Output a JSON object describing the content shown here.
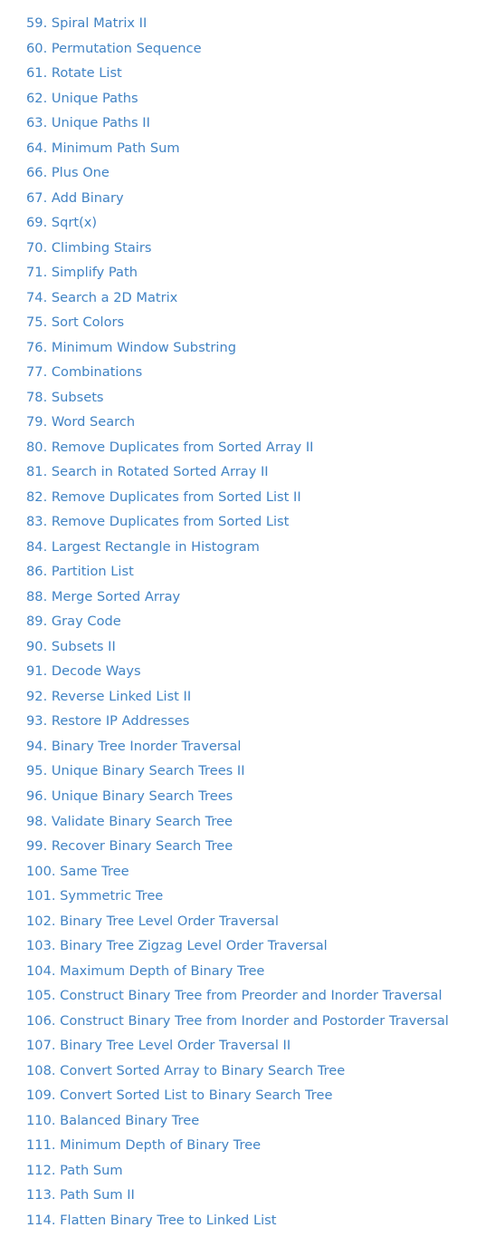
{
  "link_color": "#4183c4",
  "problems": [
    "59. Spiral Matrix II",
    "60. Permutation Sequence",
    "61. Rotate List",
    "62. Unique Paths",
    "63. Unique Paths II",
    "64. Minimum Path Sum",
    "66. Plus One",
    "67. Add Binary",
    "69. Sqrt(x)",
    "70. Climbing Stairs",
    "71. Simplify Path",
    "74. Search a 2D Matrix",
    "75. Sort Colors",
    "76. Minimum Window Substring",
    "77. Combinations",
    "78. Subsets",
    "79. Word Search",
    "80. Remove Duplicates from Sorted Array II",
    "81. Search in Rotated Sorted Array II",
    "82. Remove Duplicates from Sorted List II",
    "83. Remove Duplicates from Sorted List",
    "84. Largest Rectangle in Histogram",
    "86. Partition List",
    "88. Merge Sorted Array",
    "89. Gray Code",
    "90. Subsets II",
    "91. Decode Ways",
    "92. Reverse Linked List II",
    "93. Restore IP Addresses",
    "94. Binary Tree Inorder Traversal",
    "95. Unique Binary Search Trees II",
    "96. Unique Binary Search Trees",
    "98. Validate Binary Search Tree",
    "99. Recover Binary Search Tree",
    "100. Same Tree",
    "101. Symmetric Tree",
    "102. Binary Tree Level Order Traversal",
    "103. Binary Tree Zigzag Level Order Traversal",
    "104. Maximum Depth of Binary Tree",
    "105. Construct Binary Tree from Preorder and Inorder Traversal",
    "106. Construct Binary Tree from Inorder and Postorder Traversal",
    "107. Binary Tree Level Order Traversal II",
    "108. Convert Sorted Array to Binary Search Tree",
    "109. Convert Sorted List to Binary Search Tree",
    "110. Balanced Binary Tree",
    "111. Minimum Depth of Binary Tree",
    "112. Path Sum",
    "113. Path Sum II",
    "114. Flatten Binary Tree to Linked List"
  ]
}
